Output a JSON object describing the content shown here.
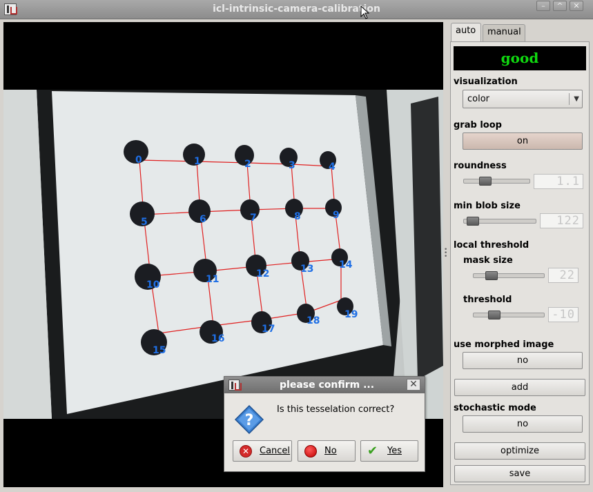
{
  "window": {
    "title": "icl-intrinsic-camera-calibration",
    "buttons": [
      "–",
      "^",
      "✕"
    ]
  },
  "tabs": [
    {
      "label": "auto",
      "active": true
    },
    {
      "label": "manual",
      "active": false
    }
  ],
  "status": {
    "text": "good",
    "color": "#10d810"
  },
  "controls": {
    "visualization": {
      "label": "visualization",
      "value": "color"
    },
    "grab_loop": {
      "label": "grab loop",
      "value": "on"
    },
    "roundness": {
      "label": "roundness",
      "level": 0.28,
      "lcd": "1.1"
    },
    "min_blob_size": {
      "label": "min blob size",
      "level": 0.05,
      "lcd": "122"
    },
    "local_threshold": {
      "label": "local threshold",
      "mask_size": {
        "label": "mask size",
        "level": 0.2,
        "lcd": "22"
      },
      "threshold": {
        "label": "threshold",
        "level": 0.25,
        "lcd": "-10"
      }
    },
    "use_morphed_image": {
      "label": "use morphed image",
      "value": "no"
    },
    "add_button": "add",
    "stochastic_mode": {
      "label": "stochastic mode",
      "value": "no"
    },
    "optimize_button": "optimize",
    "save_button": "save"
  },
  "blobs": [
    "0",
    "1",
    "2",
    "3",
    "4",
    "5",
    "6",
    "7",
    "8",
    "9",
    "10",
    "11",
    "12",
    "13",
    "14",
    "15",
    "16",
    "17",
    "18",
    "19"
  ],
  "dialog": {
    "title": "please confirm ...",
    "close": "✕",
    "message": "Is this tesselation correct?",
    "buttons": {
      "cancel": "Cancel",
      "no": "No",
      "yes": "Yes"
    }
  }
}
